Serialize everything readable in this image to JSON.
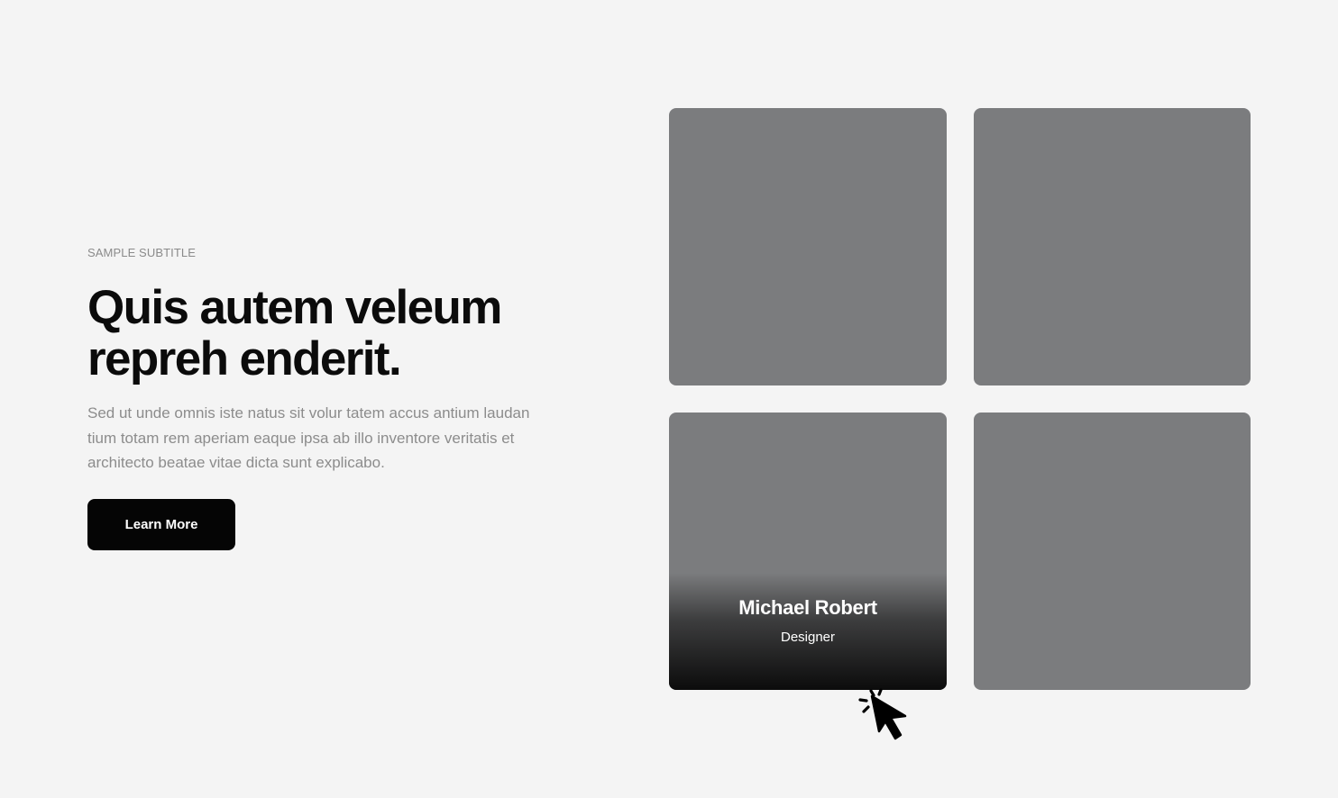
{
  "hero": {
    "subtitle": "SAMPLE SUBTITLE",
    "headline_lines": [
      "Quis autem veleum",
      "repreh enderit."
    ],
    "body_lines": [
      "Sed ut unde omnis iste natus sit volur tatem accus antium laudan",
      "tium totam rem aperiam eaque ipsa ab illo inventore veritatis et",
      "architecto beatae vitae dicta sunt explicabo."
    ],
    "button_label": "Learn More"
  },
  "team": {
    "highlighted_card": {
      "name": "Michael Robert",
      "role": "Designer"
    }
  },
  "icons": {
    "pointer": "click-cursor-icon"
  },
  "colors": {
    "background": "#f4f4f4",
    "card_placeholder": "#7b7c7e",
    "button": "#050505",
    "headline": "#0b0b0b",
    "muted_text": "#8c8c8c"
  }
}
